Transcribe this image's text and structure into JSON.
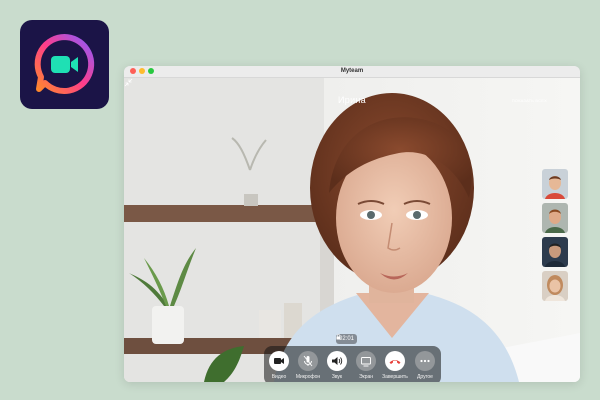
{
  "window": {
    "title": "Myteam"
  },
  "call": {
    "caller_name": "Ирина",
    "show_all_label": "ПОКАЗАТЬ ВСЕХ",
    "duration": "02:01"
  },
  "participants": [
    {
      "icon": "participant-avatar"
    },
    {
      "icon": "participant-avatar"
    },
    {
      "icon": "participant-avatar"
    },
    {
      "icon": "participant-avatar"
    }
  ],
  "controls": [
    {
      "id": "video",
      "label": "Видео",
      "icon": "camera-icon"
    },
    {
      "id": "mic",
      "label": "Микрофон",
      "icon": "microphone-icon"
    },
    {
      "id": "sound",
      "label": "Звук",
      "icon": "speaker-icon"
    },
    {
      "id": "screen",
      "label": "Экран",
      "icon": "screen-share-icon"
    },
    {
      "id": "end",
      "label": "Завершить",
      "icon": "hang-up-icon"
    },
    {
      "id": "more",
      "label": "Другое",
      "icon": "more-icon"
    }
  ],
  "colors": {
    "background": "#c9dccd",
    "app_icon_bg": "#1b1447",
    "hang_up": "#e8413b"
  }
}
